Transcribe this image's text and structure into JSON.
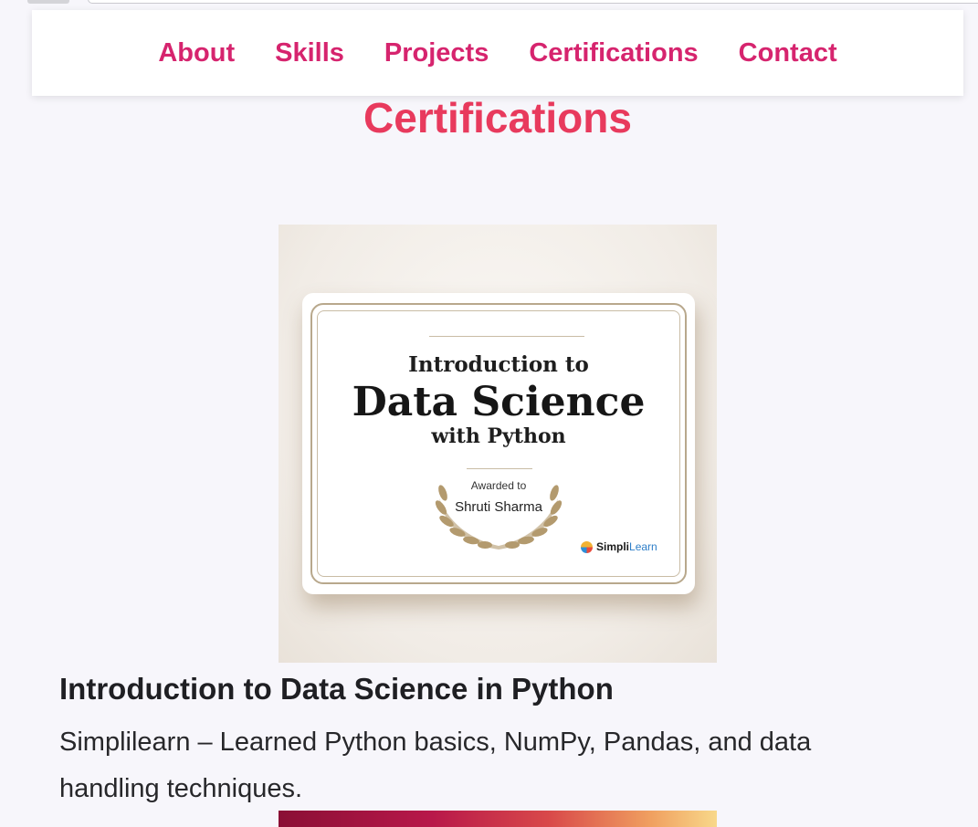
{
  "nav": {
    "items": [
      {
        "label": "About"
      },
      {
        "label": "Skills"
      },
      {
        "label": "Projects"
      },
      {
        "label": "Certifications"
      },
      {
        "label": "Contact"
      }
    ]
  },
  "section": {
    "title": "Certifications"
  },
  "certificate_image": {
    "line1": "Introduction to",
    "line2": "Data Science",
    "line3": "with Python",
    "awarded_to": "Awarded to",
    "recipient": "Shruti Sharma",
    "logo_simpli": "Simpli",
    "logo_learn": "Learn"
  },
  "certification": {
    "title": "Introduction to Data Science in Python",
    "description": "Simplilearn – Learned Python basics, NumPy, Pandas, and data handling techniques."
  },
  "colors": {
    "nav_link": "#d6246e",
    "section_title": "#e83a5d",
    "page_background": "#f7f6fb"
  }
}
